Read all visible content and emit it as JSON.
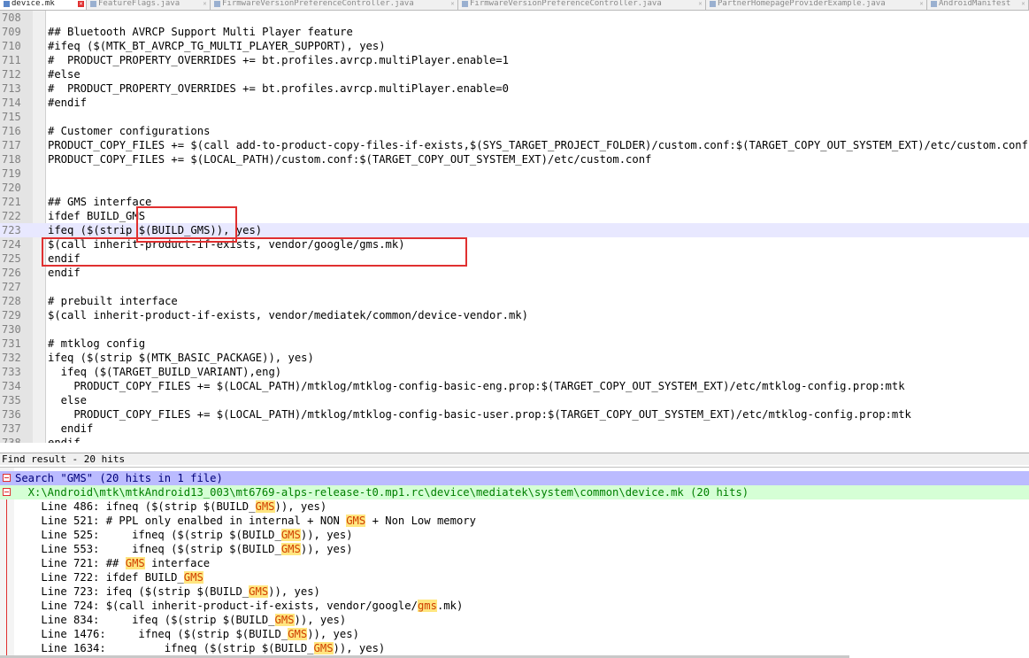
{
  "tabs": [
    {
      "label": "device.mk",
      "active": true
    },
    {
      "label": "FeatureFlags.java",
      "active": false
    },
    {
      "label": "FirmwareVersionPreferenceController.java",
      "active": false
    },
    {
      "label": "FirmwareVersionPreferenceController.java",
      "active": false
    },
    {
      "label": "PartnerHomepageProviderExample.java",
      "active": false
    },
    {
      "label": "AndroidManifest",
      "active": false
    }
  ],
  "editor": {
    "lines": [
      {
        "n": "708",
        "text": ""
      },
      {
        "n": "709",
        "text": "## Bluetooth AVRCP Support Multi Player feature"
      },
      {
        "n": "710",
        "text": "#ifeq ($(MTK_BT_AVRCP_TG_MULTI_PLAYER_SUPPORT), yes)"
      },
      {
        "n": "711",
        "text": "#  PRODUCT_PROPERTY_OVERRIDES += bt.profiles.avrcp.multiPlayer.enable=1"
      },
      {
        "n": "712",
        "text": "#else"
      },
      {
        "n": "713",
        "text": "#  PRODUCT_PROPERTY_OVERRIDES += bt.profiles.avrcp.multiPlayer.enable=0"
      },
      {
        "n": "714",
        "text": "#endif"
      },
      {
        "n": "715",
        "text": ""
      },
      {
        "n": "716",
        "text": "# Customer configurations"
      },
      {
        "n": "717",
        "text": "PRODUCT_COPY_FILES += $(call add-to-product-copy-files-if-exists,$(SYS_TARGET_PROJECT_FOLDER)/custom.conf:$(TARGET_COPY_OUT_SYSTEM_EXT)/etc/custom.conf)"
      },
      {
        "n": "718",
        "text": "PRODUCT_COPY_FILES += $(LOCAL_PATH)/custom.conf:$(TARGET_COPY_OUT_SYSTEM_EXT)/etc/custom.conf"
      },
      {
        "n": "719",
        "text": ""
      },
      {
        "n": "720",
        "text": ""
      },
      {
        "n": "721",
        "text": "## GMS interface"
      },
      {
        "n": "722",
        "text": "ifdef BUILD_GMS"
      },
      {
        "n": "723",
        "text": "ifeq ($(strip $(BUILD_GMS)), yes)",
        "current": true
      },
      {
        "n": "724",
        "text": "$(call inherit-product-if-exists, vendor/google/gms.mk)"
      },
      {
        "n": "725",
        "text": "endif"
      },
      {
        "n": "726",
        "text": "endif"
      },
      {
        "n": "727",
        "text": ""
      },
      {
        "n": "728",
        "text": "# prebuilt interface"
      },
      {
        "n": "729",
        "text": "$(call inherit-product-if-exists, vendor/mediatek/common/device-vendor.mk)"
      },
      {
        "n": "730",
        "text": ""
      },
      {
        "n": "731",
        "text": "# mtklog config"
      },
      {
        "n": "732",
        "text": "ifeq ($(strip $(MTK_BASIC_PACKAGE)), yes)"
      },
      {
        "n": "733",
        "text": "  ifeq ($(TARGET_BUILD_VARIANT),eng)"
      },
      {
        "n": "734",
        "text": "    PRODUCT_COPY_FILES += $(LOCAL_PATH)/mtklog/mtklog-config-basic-eng.prop:$(TARGET_COPY_OUT_SYSTEM_EXT)/etc/mtklog-config.prop:mtk"
      },
      {
        "n": "735",
        "text": "  else"
      },
      {
        "n": "736",
        "text": "    PRODUCT_COPY_FILES += $(LOCAL_PATH)/mtklog/mtklog-config-basic-user.prop:$(TARGET_COPY_OUT_SYSTEM_EXT)/etc/mtklog-config.prop:mtk"
      },
      {
        "n": "737",
        "text": "  endif"
      },
      {
        "n": "738",
        "text": "endif"
      }
    ]
  },
  "find": {
    "header": "Find result - 20 hits",
    "search_line": "Search \"GMS\" (20 hits in 1 file)",
    "file_line": "  X:\\Android\\mtk\\mtkAndroid13_003\\mt6769-alps-release-t0.mp1.rc\\device\\mediatek\\system\\common\\device.mk (20 hits)",
    "results": [
      {
        "pre": "    Line 486: ifneq ($(strip $(BUILD_",
        "mark": "GMS",
        "post": ")), yes)"
      },
      {
        "pre": "    Line 521: # PPL only enalbed in internal + NON ",
        "mark": "GMS",
        "post": " + Non Low memory"
      },
      {
        "pre": "    Line 525:     ifneq ($(strip $(BUILD_",
        "mark": "GMS",
        "post": ")), yes)"
      },
      {
        "pre": "    Line 553:     ifneq ($(strip $(BUILD_",
        "mark": "GMS",
        "post": ")), yes)"
      },
      {
        "pre": "    Line 721: ## ",
        "mark": "GMS",
        "post": " interface"
      },
      {
        "pre": "    Line 722: ifdef BUILD_",
        "mark": "GMS",
        "post": ""
      },
      {
        "pre": "    Line 723: ifeq ($(strip $(BUILD_",
        "mark": "GMS",
        "post": ")), yes)"
      },
      {
        "pre": "    Line 724: $(call inherit-product-if-exists, vendor/google/",
        "mark": "gms",
        "post": ".mk)"
      },
      {
        "pre": "    Line 834:     ifeq ($(strip $(BUILD_",
        "mark": "GMS",
        "post": ")), yes)"
      },
      {
        "pre": "    Line 1476:     ifneq ($(strip $(BUILD_",
        "mark": "GMS",
        "post": ")), yes)"
      },
      {
        "pre": "    Line 1634:         ifneq ($(strip $(BUILD_",
        "mark": "GMS",
        "post": ")), yes)"
      }
    ]
  }
}
